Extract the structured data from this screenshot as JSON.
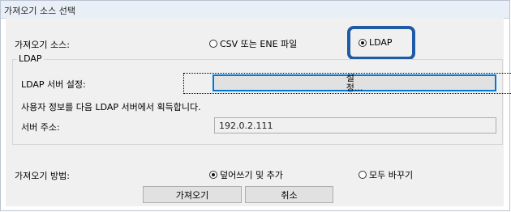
{
  "dialog": {
    "title": "가져오기 소스 선택"
  },
  "source": {
    "label": "가져오기 소스:",
    "options": [
      {
        "label": "CSV 또는 ENE 파일",
        "selected": false
      },
      {
        "label": "LDAP",
        "selected": true
      }
    ]
  },
  "ldap_group": {
    "title": "LDAP",
    "server_settings_label": "LDAP 서버 설정:",
    "settings_button": "설정...",
    "info_text": "사용자 정보를 다음 LDAP 서버에서 획득합니다.",
    "server_address_label": "서버 주소:",
    "server_address_value": "192.0.2.111"
  },
  "method": {
    "label": "가져오기 방법:",
    "options": [
      {
        "label": "덮어쓰기 및 추가",
        "selected": true
      },
      {
        "label": "모두 바꾸기",
        "selected": false
      }
    ]
  },
  "buttons": {
    "import": "가져오기",
    "cancel": "취소"
  },
  "colors": {
    "highlight": "#1f5aa6",
    "panel_bg": "#f0f0f0",
    "title_bg": "#e9eff7"
  }
}
